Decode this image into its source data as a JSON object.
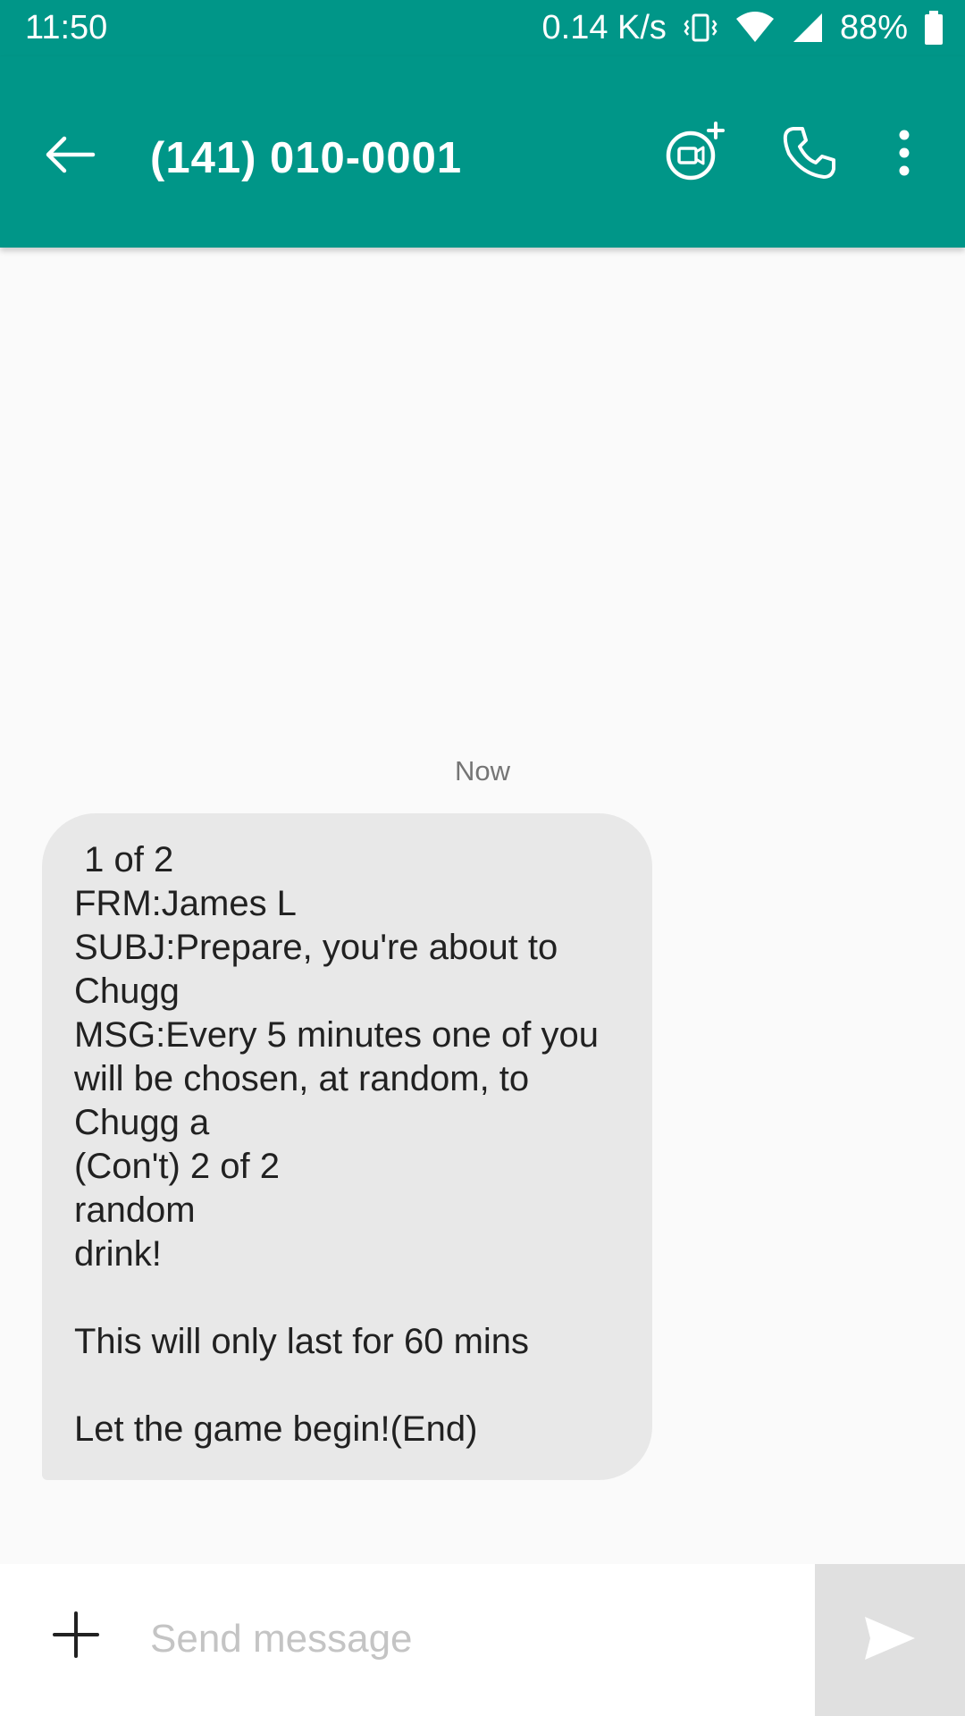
{
  "status_bar": {
    "time": "11:50",
    "network_speed": "0.14 K/s",
    "battery": "88%",
    "icons": [
      "vibrate-icon",
      "wifi-icon",
      "cell-signal-icon",
      "battery-icon"
    ]
  },
  "app_bar": {
    "title": "(141) 010-0001",
    "background_color": "#009688",
    "icons": [
      "back-arrow-icon",
      "video-call-add-icon",
      "phone-icon",
      "more-vert-icon"
    ]
  },
  "conversation": {
    "timestamp": "Now",
    "messages": [
      {
        "direction": "incoming",
        "text": " 1 of 2\nFRM:James L\nSUBJ:Prepare, you're about to\nChugg\nMSG:Every 5 minutes one of you\nwill be chosen, at random, to\nChugg a\n(Con't) 2 of 2\nrandom\ndrink!\n\nThis will only last for 60 mins\n\nLet the game begin!(End)"
      }
    ]
  },
  "composer": {
    "value": "",
    "placeholder": "Send message",
    "icons": [
      "add-icon",
      "send-icon"
    ]
  }
}
